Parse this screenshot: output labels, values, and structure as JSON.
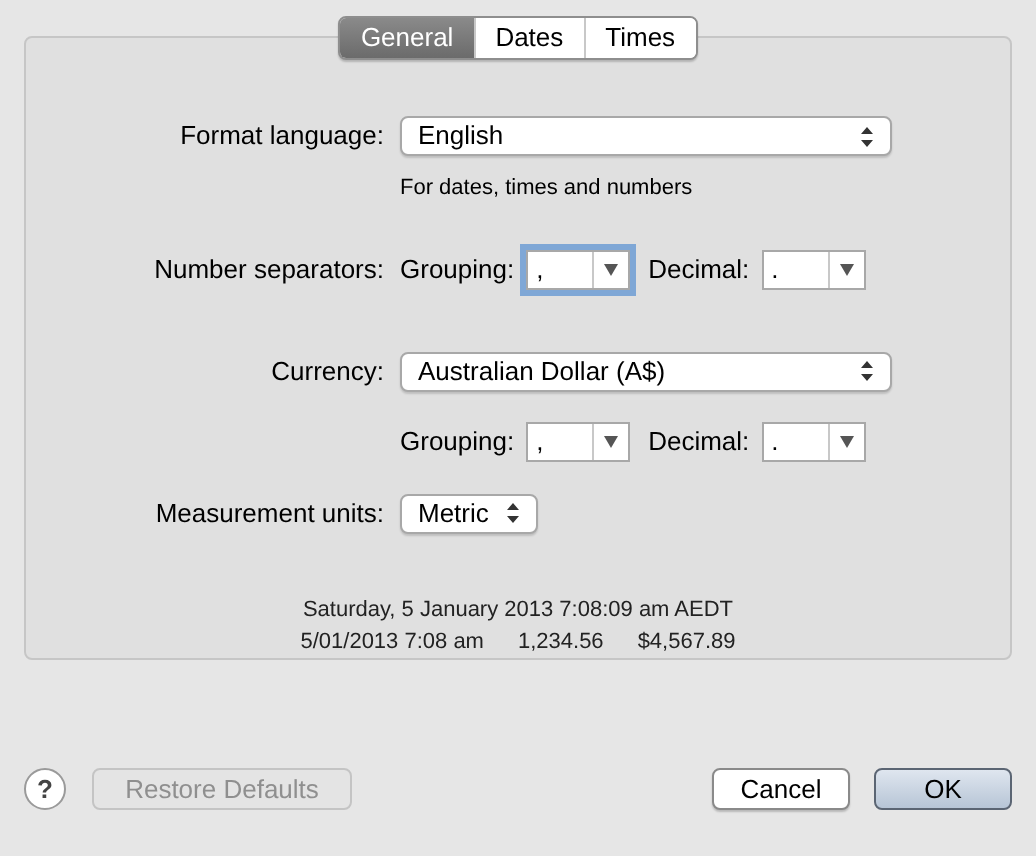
{
  "tabs": [
    {
      "label": "General",
      "selected": true
    },
    {
      "label": "Dates",
      "selected": false
    },
    {
      "label": "Times",
      "selected": false
    }
  ],
  "format_language": {
    "label": "Format language:",
    "value": "English",
    "hint": "For dates, times and numbers"
  },
  "number_separators": {
    "label": "Number separators:",
    "grouping": {
      "label": "Grouping:",
      "value": ",",
      "focused": true
    },
    "decimal": {
      "label": "Decimal:",
      "value": ".",
      "focused": false
    }
  },
  "currency": {
    "label": "Currency:",
    "value": "Australian Dollar (A$)",
    "grouping": {
      "label": "Grouping:",
      "value": ",",
      "focused": false
    },
    "decimal": {
      "label": "Decimal:",
      "value": ".",
      "focused": false
    }
  },
  "measurement_units": {
    "label": "Measurement units:",
    "value": "Metric"
  },
  "sample": {
    "date_line": "Saturday, 5 January 2013 7:08:09 am AEDT",
    "values": [
      "5/01/2013 7:08 am",
      "1,234.56",
      "$4,567.89"
    ]
  },
  "buttons": [
    {
      "label": "?",
      "kind": "help"
    },
    {
      "label": "Restore Defaults",
      "kind": "plain",
      "disabled": true
    },
    {
      "label": "Cancel",
      "kind": "plain",
      "disabled": false
    },
    {
      "label": "OK",
      "kind": "default"
    }
  ]
}
